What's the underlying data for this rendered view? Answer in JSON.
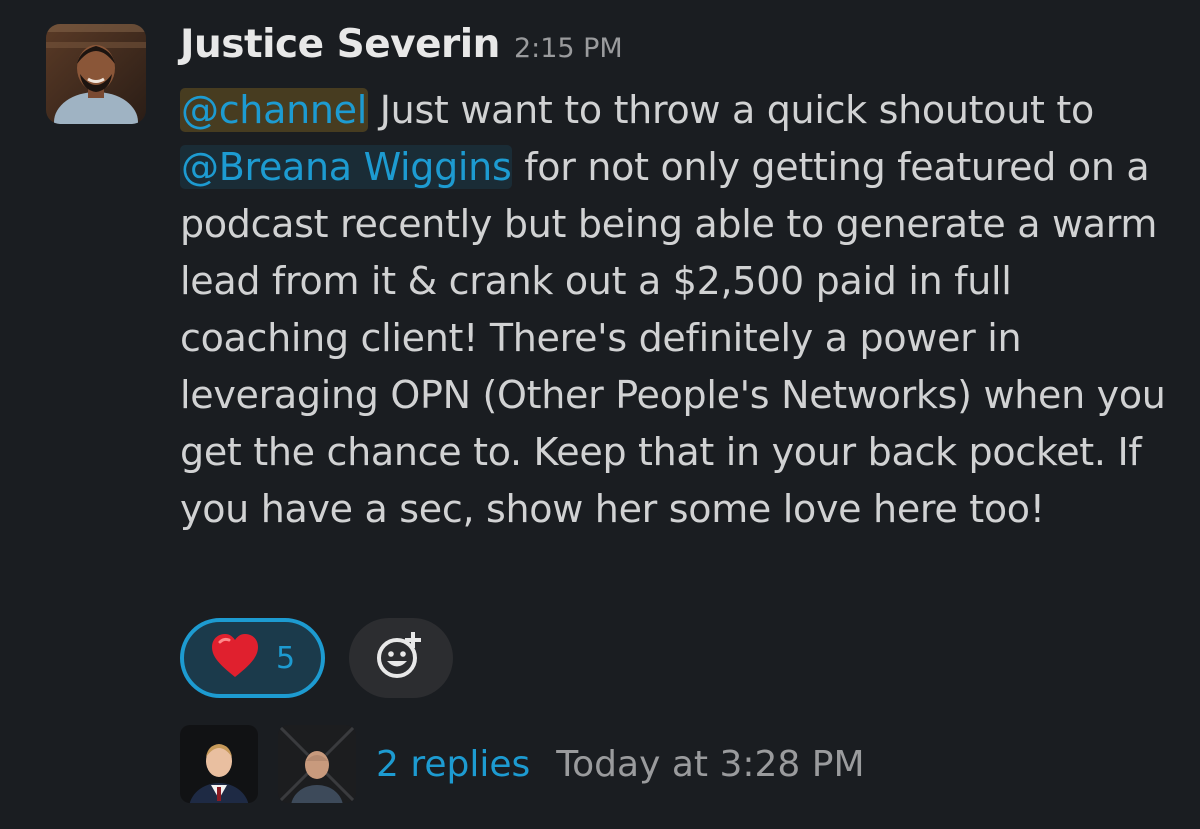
{
  "message": {
    "author": "Justice Severin",
    "timestamp": "2:15 PM",
    "channel_mention": "@channel",
    "text_1": " Just want to throw a quick shoutout to ",
    "user_mention": "@Breana Wiggins",
    "text_2": " for not only getting featured on a podcast recently but being able to generate a warm lead from it & crank out a $2,500 paid in full coaching client! There's definitely a power in leveraging OPN (Other People's Networks) when you get the chance to. Keep that in your back pocket. If you have a sec, show her some love here too!"
  },
  "reactions": [
    {
      "emoji": "heart-icon",
      "count": "5"
    }
  ],
  "thread": {
    "replies_label": "2 replies",
    "last_reply": "Today at 3:28 PM"
  },
  "colors": {
    "background": "#1a1d21",
    "link": "#1d9bd1",
    "text": "#d1d2d3",
    "muted": "#9a9b9d"
  }
}
